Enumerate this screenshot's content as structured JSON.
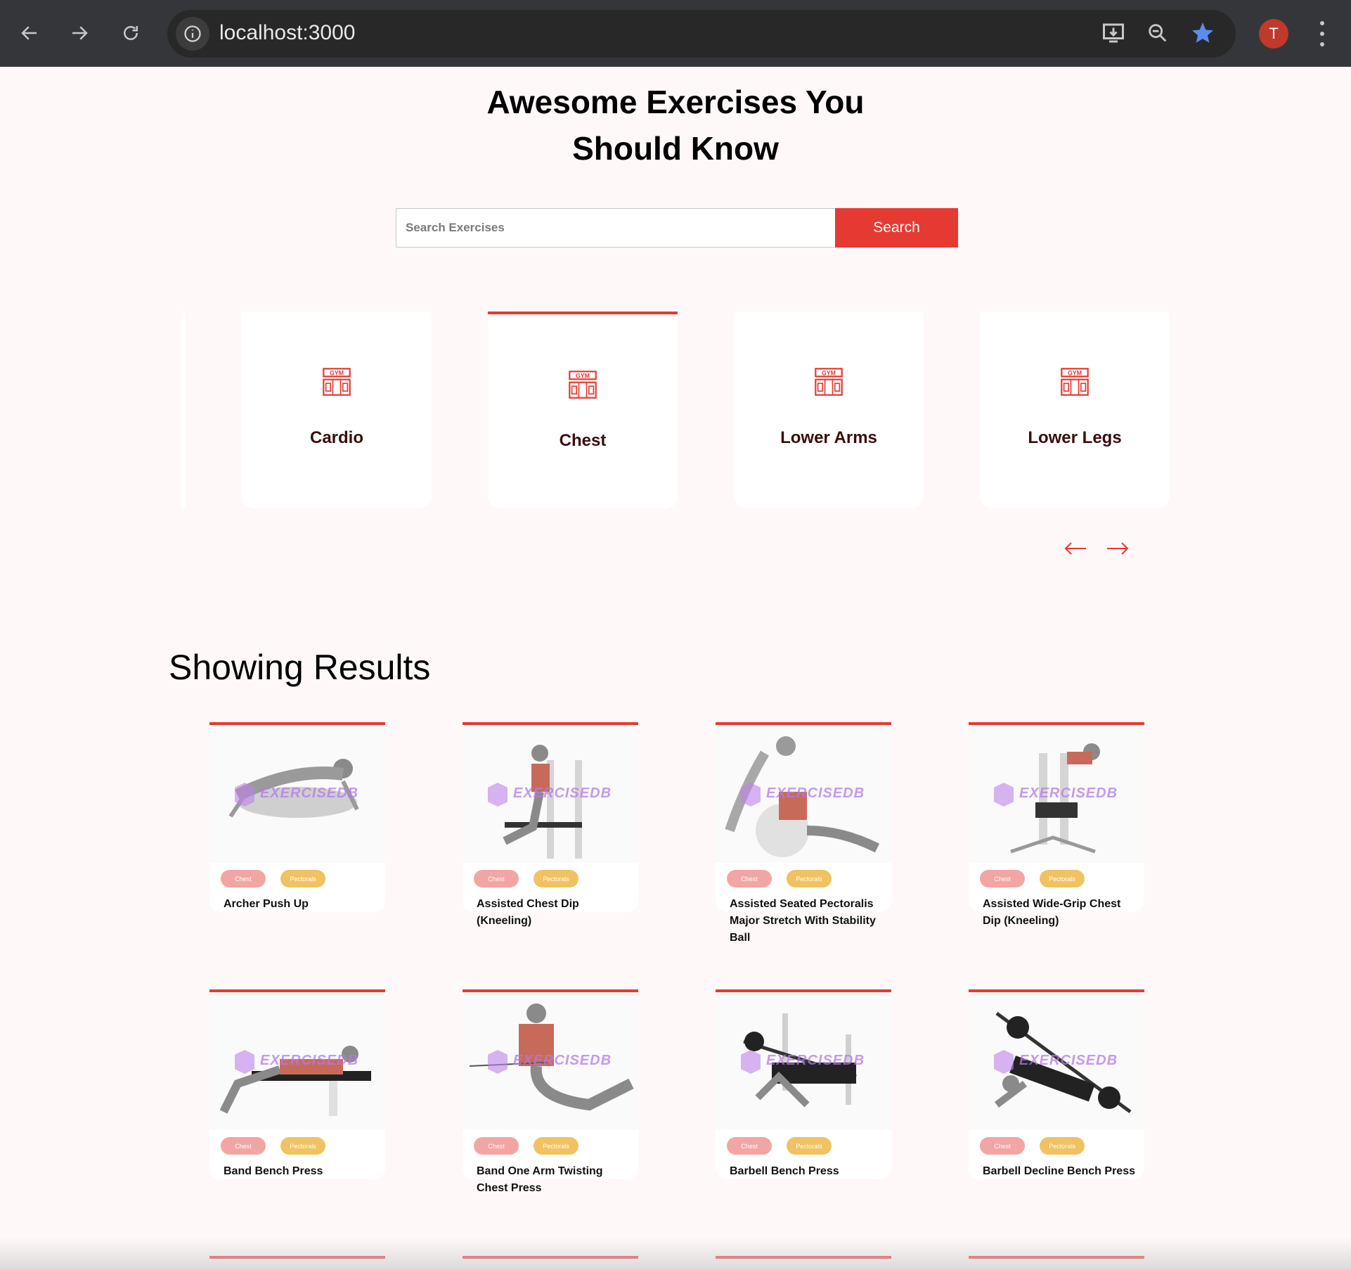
{
  "browser": {
    "url": "localhost:3000",
    "avatar_initial": "T",
    "accent_star": "#5b8def"
  },
  "hero": {
    "title": "Awesome Exercises You Should Know"
  },
  "search": {
    "placeholder": "Search Exercises",
    "button_label": "Search"
  },
  "categories": [
    {
      "label": "Cardio",
      "active": false
    },
    {
      "label": "Chest",
      "active": true
    },
    {
      "label": "Lower Arms",
      "active": false
    },
    {
      "label": "Lower Legs",
      "active": false
    }
  ],
  "results": {
    "heading": "Showing Results",
    "cards": [
      {
        "name": "Archer Push Up",
        "body_part": "Chest",
        "target": "Pectorals"
      },
      {
        "name": "Assisted Chest Dip (Kneeling)",
        "body_part": "Chest",
        "target": "Pectorals"
      },
      {
        "name": "Assisted Seated Pectoralis Major Stretch With Stability Ball",
        "body_part": "Chest",
        "target": "Pectorals"
      },
      {
        "name": "Assisted Wide-Grip Chest Dip (Kneeling)",
        "body_part": "Chest",
        "target": "Pectorals"
      },
      {
        "name": "Band Bench Press",
        "body_part": "Chest",
        "target": "Pectorals"
      },
      {
        "name": "Band One Arm Twisting Chest Press",
        "body_part": "Chest",
        "target": "Pectorals"
      },
      {
        "name": "Barbell Bench Press",
        "body_part": "Chest",
        "target": "Pectorals"
      },
      {
        "name": "Barbell Decline Bench Press",
        "body_part": "Chest",
        "target": "Pectorals"
      }
    ],
    "watermark": "EXERCISEDB"
  },
  "colors": {
    "accent": "#e53a32",
    "badge_body_part": "#f2a6a3",
    "badge_target": "#f0c262"
  },
  "icons": [
    "back-arrow-icon",
    "forward-arrow-icon",
    "reload-icon",
    "site-info-icon",
    "install-app-icon",
    "zoom-icon",
    "bookmark-star-icon",
    "menu-kebab-icon",
    "gym-icon",
    "arrow-left-icon",
    "arrow-right-icon"
  ]
}
